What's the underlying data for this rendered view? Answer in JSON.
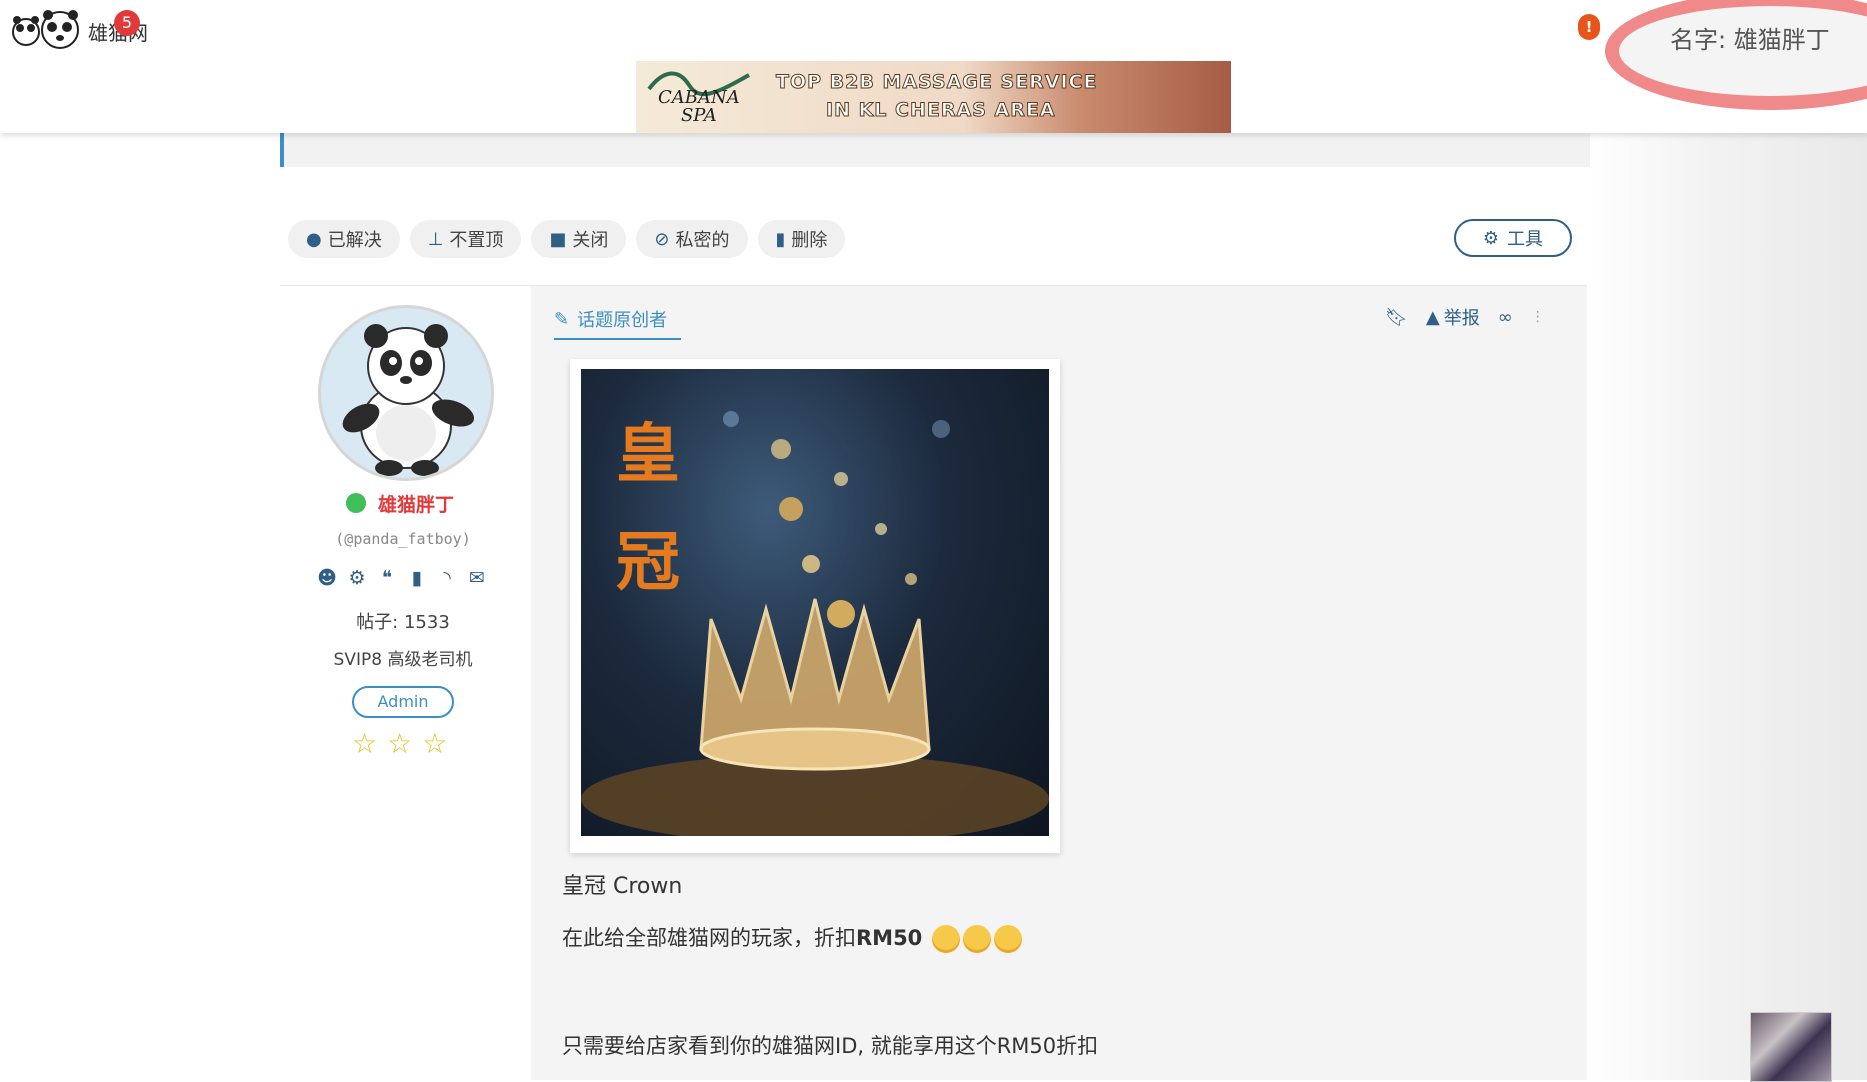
{
  "header": {
    "site_name": "雄猫网",
    "notification_count": "5",
    "alert_mark": "!",
    "user_label": "名字: 雄猫胖丁"
  },
  "ad": {
    "brand_line1": "CABANA",
    "brand_line2": "SPA",
    "line1": "TOP B2B MASSAGE SERVICE",
    "line2": "IN KL CHERAS AREA"
  },
  "toolbar": {
    "pills": [
      {
        "label": "已解决",
        "icon": "check-circle-icon"
      },
      {
        "label": "不置顶",
        "icon": "pin-icon"
      },
      {
        "label": "关闭",
        "icon": "lock-icon"
      },
      {
        "label": "私密的",
        "icon": "eye-slash-icon"
      },
      {
        "label": "删除",
        "icon": "trash-icon"
      }
    ],
    "tools_label": "工具"
  },
  "author": {
    "name": "雄猫胖丁",
    "handle": "(@panda_fatboy)",
    "posts": "帖子: 1533",
    "rank": "SVIP8 高级老司机",
    "role": "Admin",
    "stars": 3,
    "icons": [
      "user-icon",
      "gear-icon",
      "comments-icon",
      "bookmark-icon",
      "rss-icon",
      "envelope-icon"
    ]
  },
  "post": {
    "op_label": "话题原创者",
    "report_label": "举报",
    "image_caption": "皇\n冠",
    "title": "皇冠 Crown",
    "line2_text": "在此给全部雄猫网的玩家，折扣",
    "line2_bold": "RM50",
    "line3": "只需要给店家看到你的雄猫网ID, 就能享用这个RM50折扣"
  },
  "colors": {
    "accent": "#3b8fc4",
    "dark_accent": "#2f5f86",
    "author_name": "#e03a3a",
    "online": "#3fbf5a"
  }
}
